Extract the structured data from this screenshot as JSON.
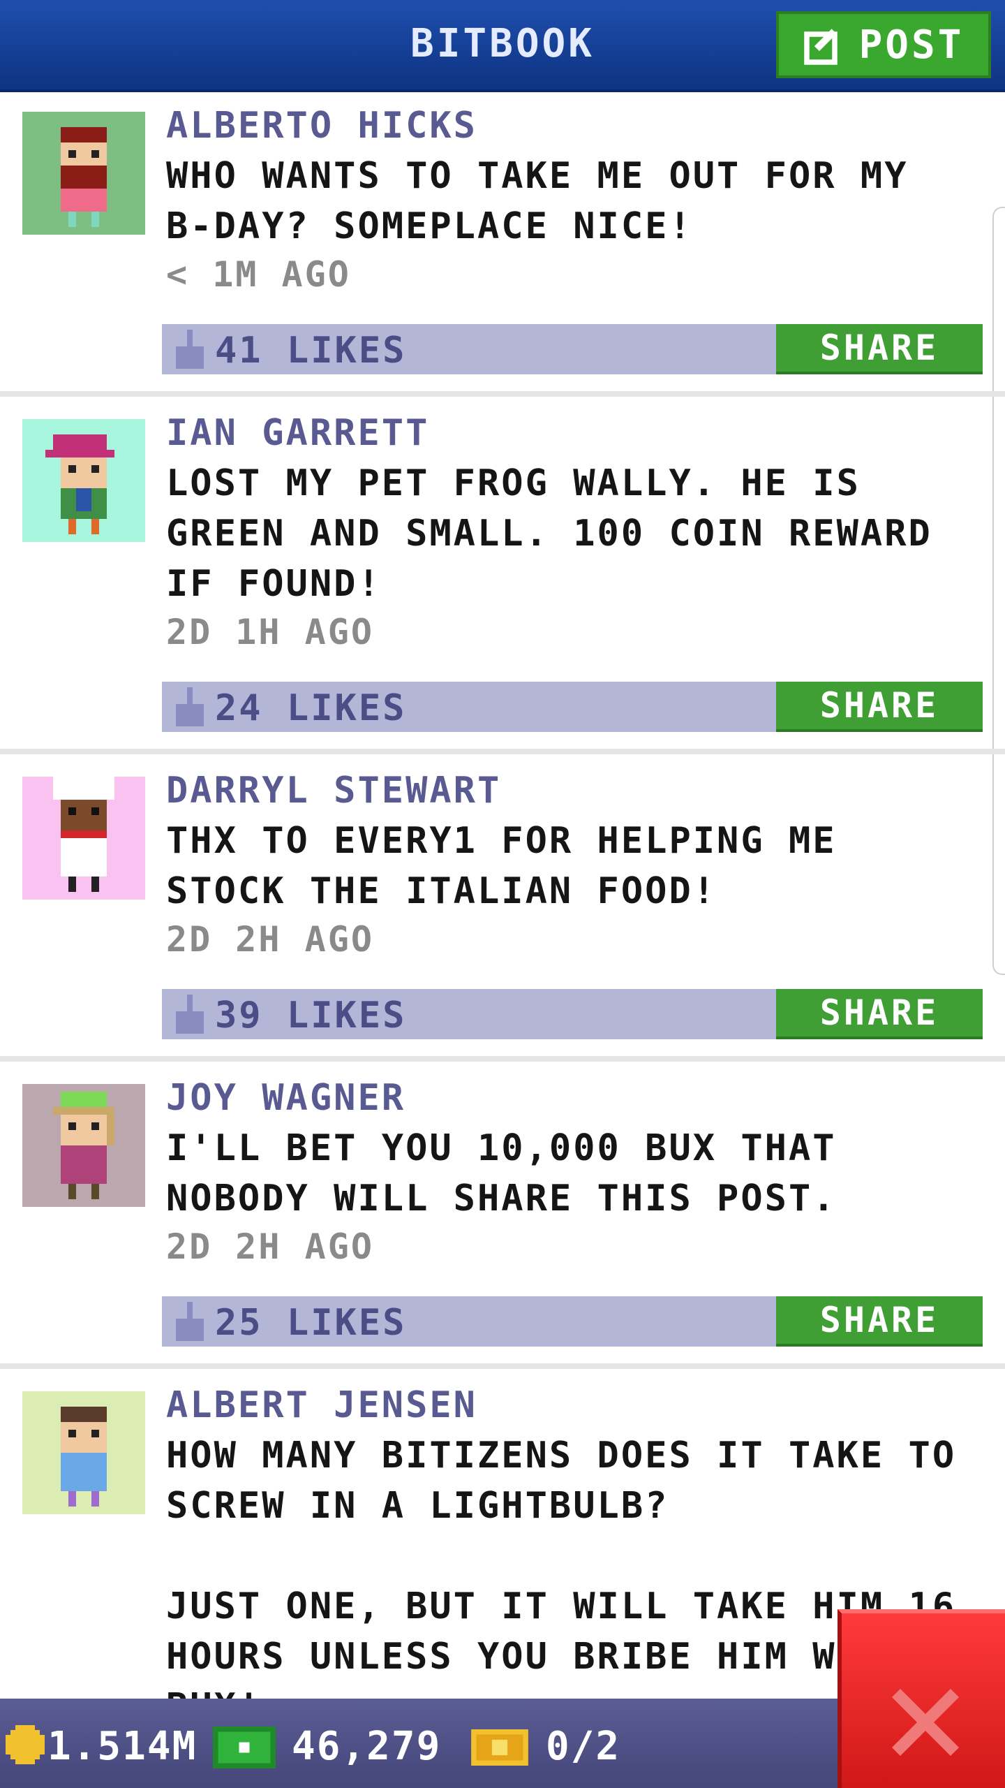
{
  "header": {
    "title": "BITBOOK",
    "post_label": "POST"
  },
  "posts": [
    {
      "author": "ALBERTO HICKS",
      "text": "WHO WANTS TO TAKE ME OUT FOR MY\nB-DAY? SOMEPLACE NICE!",
      "time": "< 1M AGO",
      "likes": "41 LIKES",
      "share": "SHARE",
      "avatar_bg": "#7fbe83"
    },
    {
      "author": "IAN GARRETT",
      "text": "LOST MY PET FROG WALLY. HE IS\nGREEN AND SMALL. 100 COIN REWARD\nIF FOUND!",
      "time": "2D 1H AGO",
      "likes": "24 LIKES",
      "share": "SHARE",
      "avatar_bg": "#a6f5dc"
    },
    {
      "author": "DARRYL STEWART",
      "text": "THX TO EVERY1 FOR HELPING ME\nSTOCK THE ITALIAN FOOD!",
      "time": "2D 2H AGO",
      "likes": "39 LIKES",
      "share": "SHARE",
      "avatar_bg": "#f9c2f1"
    },
    {
      "author": "JOY WAGNER",
      "text": "I'LL BET YOU 10,000 BUX THAT\nNOBODY WILL SHARE THIS POST.",
      "time": "2D 2H AGO",
      "likes": "25 LIKES",
      "share": "SHARE",
      "avatar_bg": "#bba7ae"
    },
    {
      "author": "ALBERT JENSEN",
      "text": "HOW MANY BITIZENS DOES IT TAKE TO\nSCREW IN A LIGHTBULB?\n\nJUST ONE, BUT IT WILL TAKE HIM 16\nHOURS UNLESS YOU BRIBE HIM WITH\nBUX!",
      "avatar_bg": "#dcedb3"
    }
  ],
  "status": {
    "coins": "1.514M",
    "bux": "46,279",
    "tickets": "0/2"
  },
  "colors": {
    "header": "#1a46a0",
    "share_green": "#3f9e34",
    "likes_bar": "#b4b6d8",
    "close_red": "#e22222"
  }
}
